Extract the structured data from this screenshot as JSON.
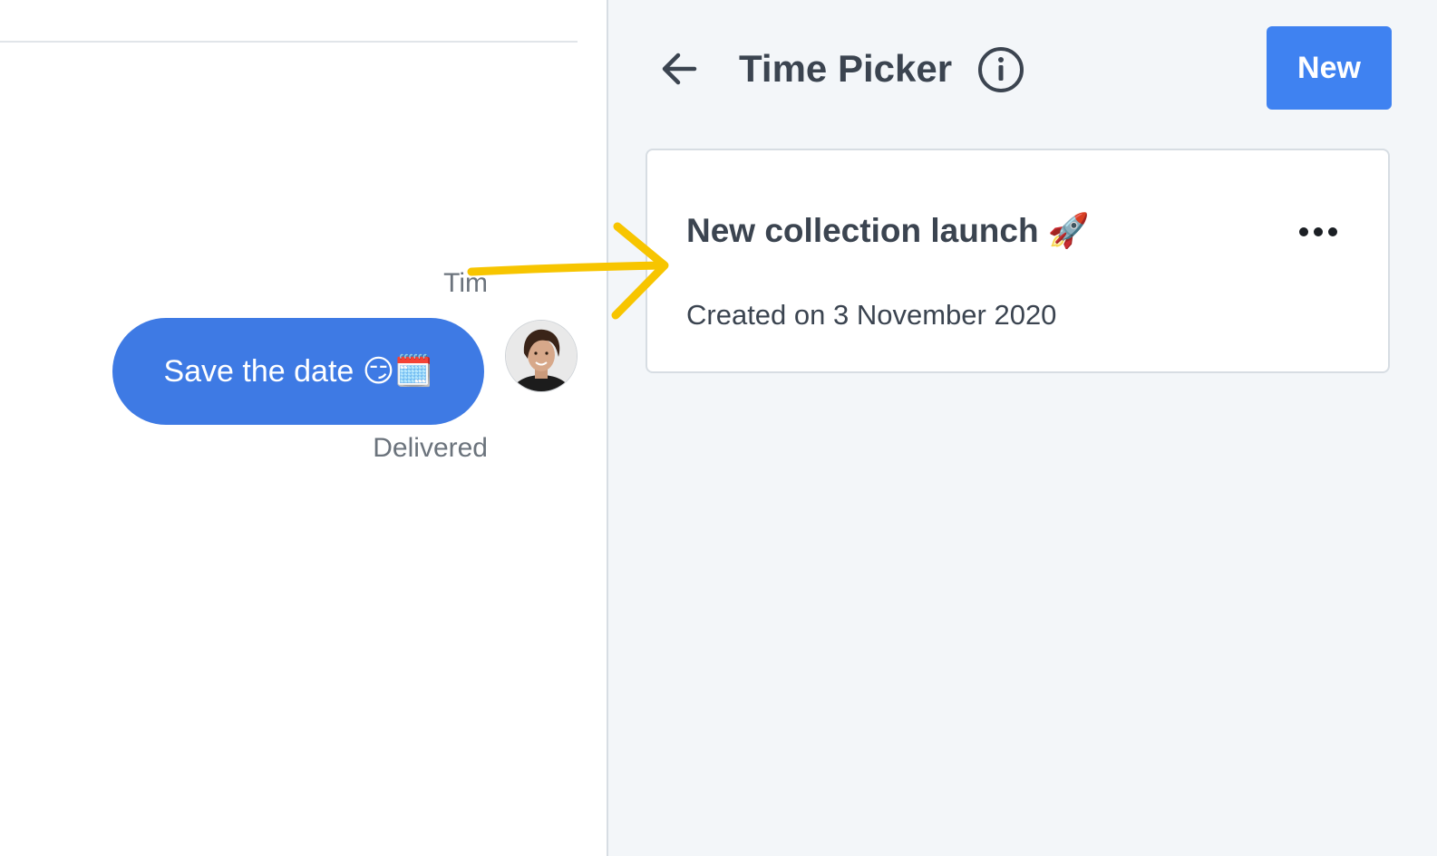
{
  "chat": {
    "sender_name": "Tim",
    "message": "Save the date 😏🗓️",
    "status": "Delivered",
    "bubble_color": "#3e7ae4"
  },
  "panel": {
    "title": "Time Picker",
    "back_icon": "arrow-left-icon",
    "info_icon": "info-icon",
    "new_button_label": "New",
    "accent_color": "#3f82f1"
  },
  "card": {
    "title": "New collection launch 🚀",
    "subtitle": "Created on 3 November 2020",
    "more_icon": "more-horizontal-icon"
  },
  "annotation": {
    "color": "#f7c500"
  }
}
